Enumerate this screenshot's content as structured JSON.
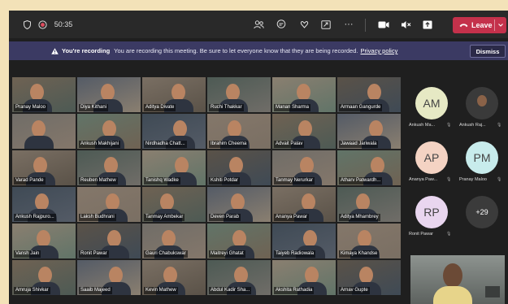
{
  "topbar": {
    "timer": "50:35",
    "leave_label": "Leave"
  },
  "banner": {
    "title": "You're recording",
    "message": "You are recording this meeting. Be sure to let everyone know that they are being recorded.",
    "link": "Privacy policy",
    "dismiss_label": "Dismiss"
  },
  "participants": [
    "Pranay Maloo",
    "Diya Kithani",
    "Aditya Divate",
    "Ruchi Thakkar",
    "Manan Sharma",
    "Armaan Gangurde",
    "",
    "Ankush Makhijani",
    "Nirdhadha Chatt...",
    "Ibrahim Cheema",
    "Advait Palav",
    "Jawaad Jariwala",
    "Varad Pande",
    "Reuben Mathew",
    "Tanishq Wadke",
    "Kshiti Potdar",
    "Tanmay Nerurkar",
    "Atharv Patwardh...",
    "Ankush Rajpuro...",
    "Laksh Budhrani",
    "Tanmay Ambekar",
    "Deven Parab",
    "Ananya Pawar",
    "Aditya Mhambrey",
    "Vansh Jain",
    "Ronit Pawar",
    "Gauri Chabukswar",
    "Maitreyi Ghatat",
    "Taiyeb Radiowala",
    "Kimaya Khandse",
    "Amruja Shivkar",
    "Saaib Majeed",
    "Kevin Mathew",
    "Abdul Kadir Sha...",
    "Akshita Rathadia",
    "Arnav Gupte"
  ],
  "side_panel": {
    "people": [
      {
        "initials": "AM",
        "name": "Ankush Ma...",
        "avatar": true,
        "bg": "#e6e9c4"
      },
      {
        "initials": "",
        "name": "Ankush Raj...",
        "avatar": false,
        "bg": "#3a3a3a"
      },
      {
        "initials": "AP",
        "name": "Ananya Paw...",
        "avatar": true,
        "bg": "#f4d3c3"
      },
      {
        "initials": "PM",
        "name": "Pranay Maloo",
        "avatar": true,
        "bg": "#c8ecec"
      },
      {
        "initials": "RP",
        "name": "Ronit Pawar",
        "avatar": true,
        "bg": "#e9d6ef"
      },
      {
        "initials": "+29",
        "name": "",
        "avatar": true,
        "bg": "#3b3b3b"
      }
    ]
  },
  "colors": {
    "leave": "#c4314b",
    "banner": "#3b3a63",
    "topbar": "#292929"
  }
}
